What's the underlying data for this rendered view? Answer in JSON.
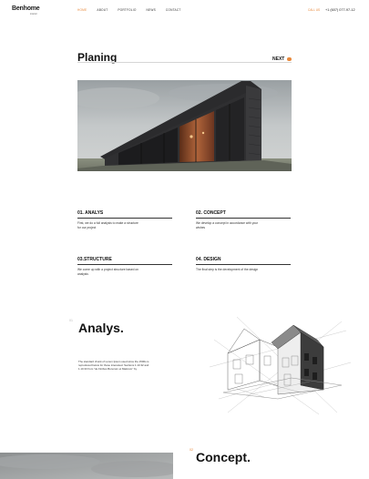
{
  "header": {
    "logo_name": "Benhome",
    "logo_sub": "interior",
    "nav": [
      "HOME",
      "ABOUT",
      "PORTFOLIO",
      "NEWS",
      "CONTACT"
    ],
    "call_label": "CALL US",
    "phone": "+1 (607) 077-97-12"
  },
  "page": {
    "title": "Planing",
    "next_label": "NEXT"
  },
  "steps": [
    {
      "title": "01. ANALYS",
      "text": "First, we do a full analysis to make a structure for our project"
    },
    {
      "title": "02. CONCEPT",
      "text": "We develop a concept in accordance with your wishes"
    },
    {
      "title": "03.STRUCTURE",
      "text": "We come up with a project structure based on analysis"
    },
    {
      "title": "04. DESIGN",
      "text": "The final step is the development of the design"
    }
  ],
  "section_analys": {
    "number": "01",
    "title": "Analys.",
    "text": "The standard chunk of Lorem Ipsum used since the 1500s is reproduced below for those interested. Sections 1.10.32 and 1.10.33 from \"de Finibus Bonorum et Malorum\" by"
  },
  "section_concept": {
    "number": "02",
    "title": "Concept."
  },
  "colors": {
    "accent": "#e8893c",
    "text": "#1a1a1a",
    "rule": "#d6d6d6"
  }
}
